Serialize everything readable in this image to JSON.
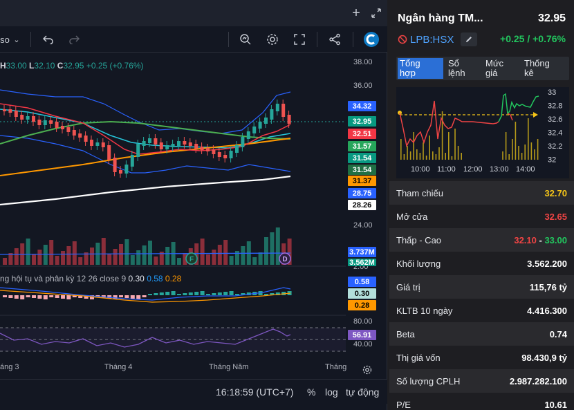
{
  "chart": {
    "ohlc": {
      "h_label": "H",
      "h": "33.00",
      "l_label": "L",
      "l": "32.10",
      "c_label": "C",
      "c": "32.95",
      "change": "+0.25 (+0.76%)"
    },
    "price_axis": [
      "38.00",
      "36.00",
      "24.00",
      "2.00",
      "80.00",
      "40.00"
    ],
    "price_tags": [
      {
        "text": "34.32",
        "bg": "#2962ff",
        "fg": "#ffffff"
      },
      {
        "text": "32.95",
        "bg": "#089981",
        "fg": "#ffffff"
      },
      {
        "text": "32.51",
        "bg": "#f23645",
        "fg": "#ffffff"
      },
      {
        "text": "31.57",
        "bg": "#26a65b",
        "fg": "#ffffff"
      },
      {
        "text": "31.54",
        "bg": "#089981",
        "fg": "#ffffff"
      },
      {
        "text": "31.54",
        "bg": "#1f6f43",
        "fg": "#ffffff"
      },
      {
        "text": "31.37",
        "bg": "#ff9800",
        "fg": "#000000"
      },
      {
        "text": "28.75",
        "bg": "#2962ff",
        "fg": "#ffffff"
      },
      {
        "text": "28.26",
        "bg": "#ffffff",
        "fg": "#000000"
      }
    ],
    "volume_tags": [
      {
        "text": "3.737M",
        "bg": "#2962ff",
        "fg": "#ffffff"
      },
      {
        "text": "3.562M",
        "bg": "#089981",
        "fg": "#ffffff"
      }
    ],
    "macd_tags": [
      {
        "text": "0.58",
        "bg": "#2962ff",
        "fg": "#ffffff"
      },
      {
        "text": "0.30",
        "bg": "#b2dfdb",
        "fg": "#000000"
      },
      {
        "text": "0.28",
        "bg": "#ff9800",
        "fg": "#000000"
      }
    ],
    "rsi_tag": {
      "text": "56.91",
      "bg": "#7e57c2",
      "fg": "#ffffff"
    },
    "indicator": {
      "name": "ng hội tụ và phân kỳ",
      "params": "12 26 close 9",
      "v1": "0.30",
      "v2": "0.58",
      "v3": "0.28"
    },
    "x_labels": [
      "áng 3",
      "Tháng 4",
      "Tháng Năm",
      "Tháng"
    ],
    "interval_label": "so",
    "markers": {
      "f": "F",
      "d": "D"
    },
    "bottom": {
      "time": "16:18:59 (UTC+7)",
      "percent": "%",
      "log": "log",
      "auto": "tự động"
    }
  },
  "info": {
    "name": "Ngân hàng TM...",
    "price": "32.95",
    "ticker": "LPB:HSX",
    "change": "+0.25 / +0.76%",
    "tabs": [
      {
        "line1": "Tổng",
        "line2": "hợp"
      },
      {
        "line1": "Sổ",
        "line2": "lệnh"
      },
      {
        "line1": "Mức",
        "line2": "giá"
      },
      {
        "line1": "Thống",
        "line2": "kê"
      }
    ],
    "mini_chart": {
      "y_labels": [
        "33",
        "32.8",
        "32.6",
        "32.4",
        "32.2",
        "32"
      ],
      "x_labels": [
        "10:00",
        "11:00",
        "12:00",
        "13:00",
        "14:00"
      ]
    },
    "stats": [
      {
        "label": "Tham chiếu",
        "value": "32.70",
        "color": "#f5c518"
      },
      {
        "label": "Mở cửa",
        "value": "32.65",
        "color": "#ef4444"
      },
      {
        "label": "Thấp - Cao",
        "low": "32.10",
        "sep": " - ",
        "high": "33.00"
      },
      {
        "label": "Khối lượng",
        "value": "3.562.200",
        "color": "#ffffff"
      },
      {
        "label": "Giá trị",
        "value": "115,76 tỷ",
        "color": "#ffffff"
      },
      {
        "label": "KLTB 10 ngày",
        "value": "4.416.300",
        "color": "#ffffff"
      },
      {
        "label": "Beta",
        "value": "0.74",
        "color": "#ffffff"
      },
      {
        "label": "Thị giá vốn",
        "value": "98.430,9 tỷ",
        "color": "#ffffff"
      },
      {
        "label": "Số lượng CPLH",
        "value": "2.987.282.100",
        "color": "#ffffff"
      },
      {
        "label": "P/E",
        "value": "10.61",
        "color": "#ffffff"
      }
    ]
  }
}
